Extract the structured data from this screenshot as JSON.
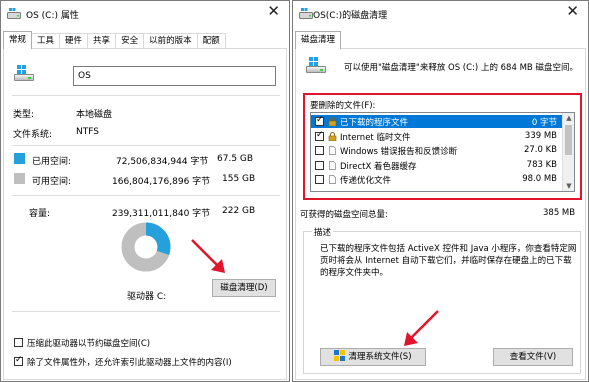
{
  "left": {
    "title": "OS (C:) 属性",
    "close": "✕",
    "tabs": [
      "常规",
      "工具",
      "硬件",
      "共享",
      "安全",
      "以前的版本",
      "配额"
    ],
    "name_value": "OS",
    "type_label": "类型:",
    "type_value": "本地磁盘",
    "fs_label": "文件系统:",
    "fs_value": "NTFS",
    "used_label": "已用空间:",
    "used_bytes": "72,506,834,944 字节",
    "used_gb": "67.5 GB",
    "free_label": "可用空间:",
    "free_bytes": "166,804,176,896 字节",
    "free_gb": "155 GB",
    "cap_label": "容量:",
    "cap_bytes": "239,311,011,840 字节",
    "cap_gb": "222 GB",
    "drive_label": "驱动器 C:",
    "cleanup_button": "磁盘清理(D)",
    "compress_label": "压缩此驱动器以节约磁盘空间(C)",
    "index_label": "除了文件属性外，还允许索引此驱动器上文件的内容(I)",
    "used_fraction": 0.303,
    "colors": {
      "used": "#26a0da",
      "free": "#bfbfbf"
    }
  },
  "right": {
    "title": "OS(C:)的磁盘清理",
    "close": "✕",
    "tab": "磁盘清理",
    "summary": "可以使用\"磁盘清理\"来释放 OS (C:) 上的 684 MB 磁盘空间。",
    "files_label": "要删除的文件(F):",
    "files": [
      {
        "checked": true,
        "icon": "lock-icon",
        "name": "已下载的程序文件",
        "size": "0 字节",
        "selected": true
      },
      {
        "checked": true,
        "icon": "lock-icon",
        "name": "Internet 临时文件",
        "size": "339 MB",
        "selected": false
      },
      {
        "checked": false,
        "icon": "file-icon",
        "name": "Windows 错误报告和反馈诊断",
        "size": "27.0 KB",
        "selected": false
      },
      {
        "checked": false,
        "icon": "file-icon",
        "name": "DirectX 着色器缓存",
        "size": "783 KB",
        "selected": false
      },
      {
        "checked": false,
        "icon": "file-icon",
        "name": "传递优化文件",
        "size": "98.0 MB",
        "selected": false
      }
    ],
    "total_label": "可获得的磁盘空间总量:",
    "total_value": "385 MB",
    "desc_label": "描述",
    "desc_line1": "已下载的程序文件包括 ActiveX 控件和 Java 小程序，你查看特定网",
    "desc_line2": "页时将会从 Internet 自动下载它们，并临时保存在硬盘上的已下载",
    "desc_line3": "的程序文件夹中。",
    "clean_system_button": "清理系统文件(S)",
    "view_files_button": "查看文件(V)"
  }
}
